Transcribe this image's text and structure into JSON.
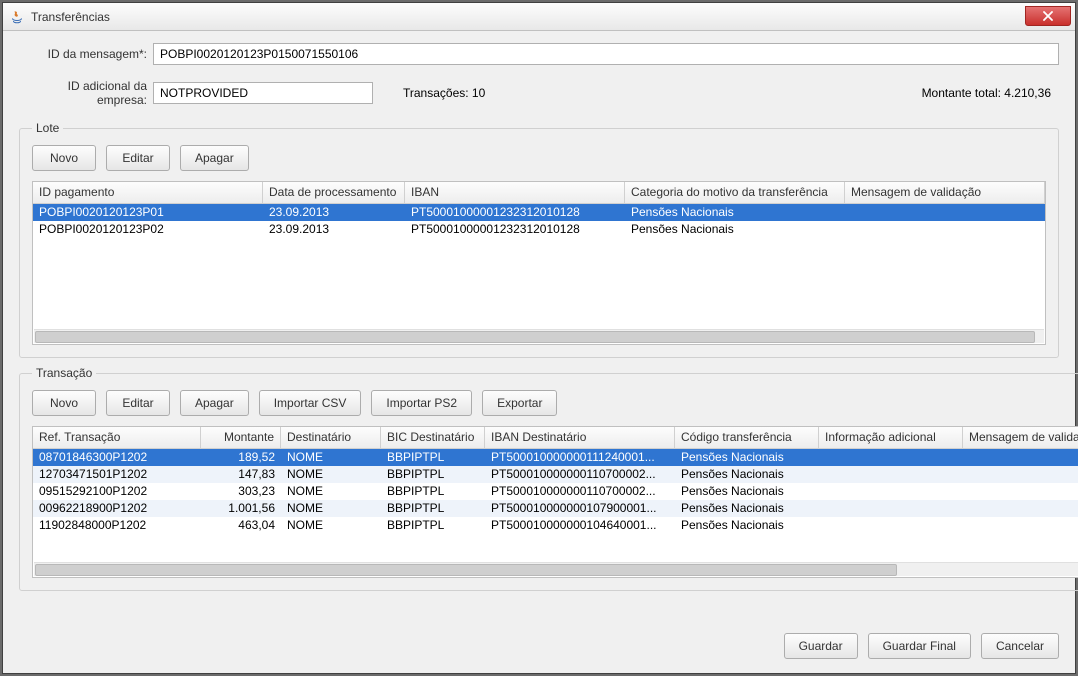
{
  "window": {
    "title": "Transferências"
  },
  "labels": {
    "id_mensagem": "ID da mensagem*:",
    "id_adicional": "ID adicional da empresa:",
    "transacoes": "Transações: 10",
    "montante_total": "Montante total: 4.210,36",
    "lote_legend": "Lote",
    "transacao_legend": "Transação"
  },
  "inputs": {
    "id_mensagem": "POBPI0020120123P0150071550106",
    "id_adicional": "NOTPROVIDED"
  },
  "buttons": {
    "novo": "Novo",
    "editar": "Editar",
    "apagar": "Apagar",
    "importar_csv": "Importar CSV",
    "importar_ps2": "Importar PS2",
    "exportar": "Exportar",
    "guardar": "Guardar",
    "guardar_final": "Guardar Final",
    "cancelar": "Cancelar"
  },
  "lote": {
    "headers": [
      "ID pagamento",
      "Data de processamento",
      "IBAN",
      "Categoria do motivo da transferência",
      "Mensagem de validação"
    ],
    "rows": [
      {
        "c0": "POBPI0020120123P01",
        "c1": "23.09.2013",
        "c2": "PT50001000001232312010128",
        "c3": "Pensões Nacionais",
        "c4": "",
        "selected": true
      },
      {
        "c0": "POBPI0020120123P02",
        "c1": "23.09.2013",
        "c2": "PT50001000001232312010128",
        "c3": "Pensões Nacionais",
        "c4": "",
        "selected": false
      }
    ]
  },
  "transacao": {
    "headers": [
      "Ref. Transação",
      "Montante",
      "Destinatário",
      "BIC Destinatário",
      "IBAN Destinatário",
      "Código transferência",
      "Informação adicional",
      "Mensagem de valida"
    ],
    "rows": [
      {
        "c0": "08701846300P1202",
        "c1": "189,52",
        "c2": "NOME",
        "c3": "BBPIPTPL",
        "c4": "PT500010000000111240001...",
        "c5": "Pensões Nacionais",
        "c6": "",
        "c7": "",
        "selected": true
      },
      {
        "c0": "12703471501P1202",
        "c1": "147,83",
        "c2": "NOME",
        "c3": "BBPIPTPL",
        "c4": "PT500010000000110700002...",
        "c5": "Pensões Nacionais",
        "c6": "",
        "c7": ""
      },
      {
        "c0": "09515292100P1202",
        "c1": "303,23",
        "c2": "NOME",
        "c3": "BBPIPTPL",
        "c4": "PT500010000000110700002...",
        "c5": "Pensões Nacionais",
        "c6": "",
        "c7": ""
      },
      {
        "c0": "00962218900P1202",
        "c1": "1.001,56",
        "c2": "NOME",
        "c3": "BBPIPTPL",
        "c4": "PT500010000000107900001...",
        "c5": "Pensões Nacionais",
        "c6": "",
        "c7": ""
      },
      {
        "c0": "11902848000P1202",
        "c1": "463,04",
        "c2": "NOME",
        "c3": "BBPIPTPL",
        "c4": "PT500010000000104640001...",
        "c5": "Pensões Nacionais",
        "c6": "",
        "c7": ""
      }
    ]
  }
}
